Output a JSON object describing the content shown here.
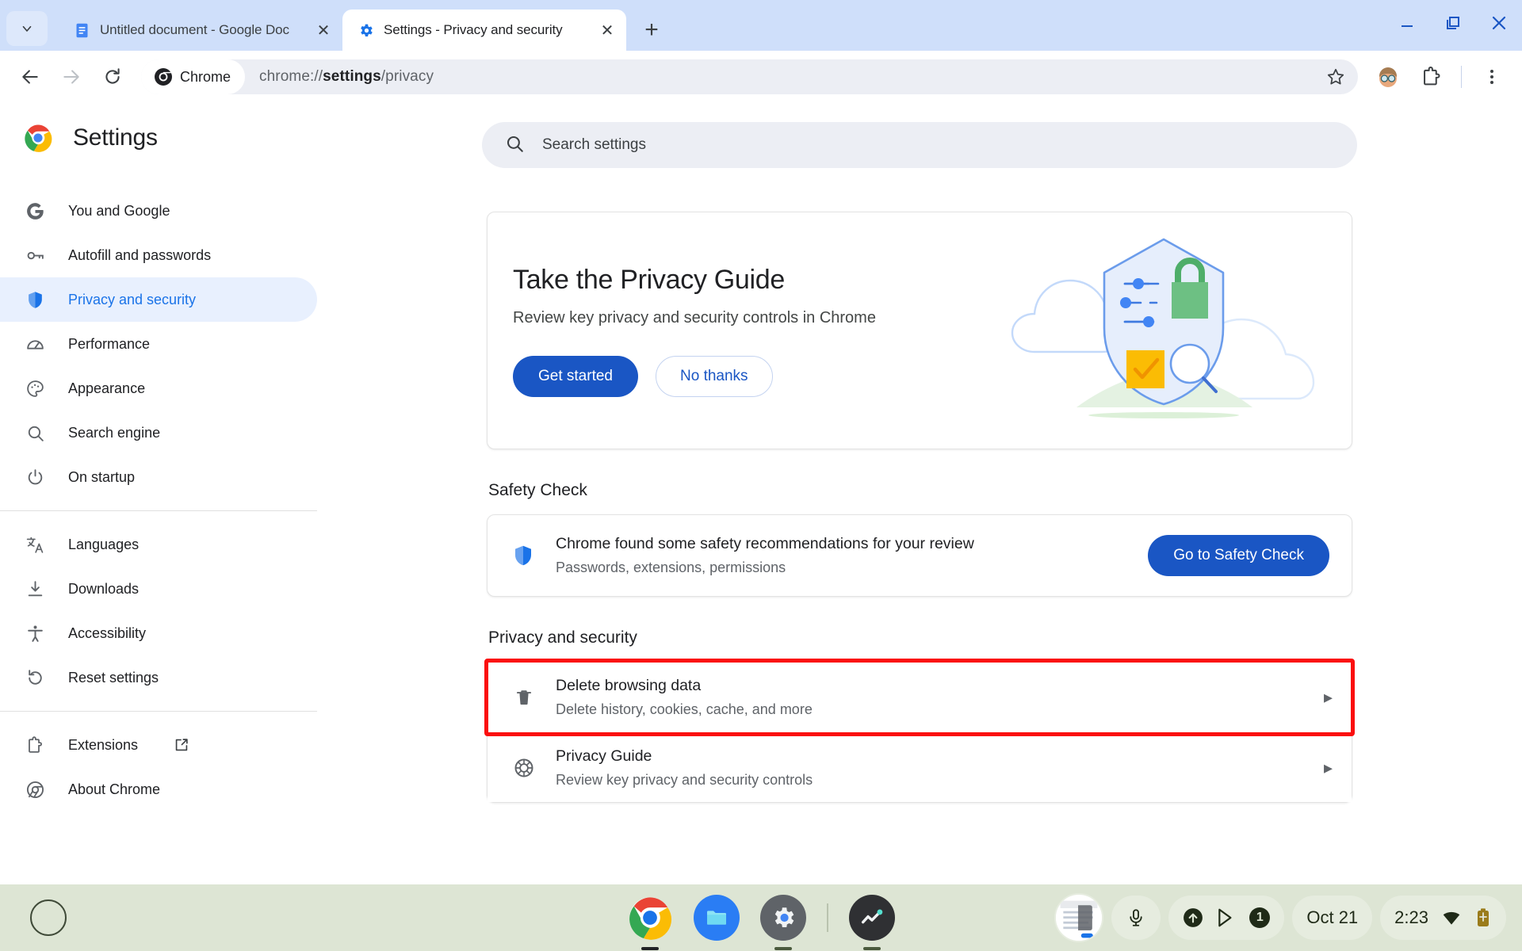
{
  "window": {
    "minimize_label": "–",
    "restore_label": "❐",
    "close_label": "✕"
  },
  "tabstrip": {
    "tab_search_icon": "chevron-down-icon",
    "new_tab_label": "+",
    "tabs": [
      {
        "title": "Untitled document - Google Doc",
        "favicon": "google-docs-icon",
        "active": false,
        "close_label": "✕"
      },
      {
        "title": "Settings - Privacy and security",
        "favicon": "settings-gear-icon",
        "active": true,
        "close_label": "✕"
      }
    ]
  },
  "toolbar": {
    "back_label": "←",
    "forward_label": "→",
    "reload_label": "⟳",
    "chrome_chip_label": "Chrome",
    "url_prefix": "chrome://",
    "url_bold": "settings",
    "url_suffix": "/privacy",
    "bookmark_icon": "star-icon",
    "profile_icon": "avatar-icon",
    "extensions_icon": "extensions-puzzle-icon",
    "menu_icon": "three-dot-menu-icon"
  },
  "sidebar": {
    "brand_title": "Settings",
    "brand_icon": "chrome-logo-icon",
    "items": [
      {
        "label": "You and Google",
        "icon": "google-g-icon",
        "selected": false
      },
      {
        "label": "Autofill and passwords",
        "icon": "key-icon",
        "selected": false
      },
      {
        "label": "Privacy and security",
        "icon": "shield-icon",
        "selected": true
      },
      {
        "label": "Performance",
        "icon": "speedometer-icon",
        "selected": false
      },
      {
        "label": "Appearance",
        "icon": "palette-icon",
        "selected": false
      },
      {
        "label": "Search engine",
        "icon": "search-icon",
        "selected": false
      },
      {
        "label": "On startup",
        "icon": "power-icon",
        "selected": false
      }
    ],
    "items_group2": [
      {
        "label": "Languages",
        "icon": "translate-icon",
        "selected": false
      },
      {
        "label": "Downloads",
        "icon": "download-icon",
        "selected": false
      },
      {
        "label": "Accessibility",
        "icon": "accessibility-icon",
        "selected": false
      },
      {
        "label": "Reset settings",
        "icon": "reset-icon",
        "selected": false
      }
    ],
    "items_group3": [
      {
        "label": "Extensions",
        "icon": "puzzle-icon",
        "external": true,
        "external_icon": "open-in-new-icon",
        "selected": false
      },
      {
        "label": "About Chrome",
        "icon": "chrome-outline-icon",
        "external": false,
        "selected": false
      }
    ]
  },
  "search": {
    "placeholder": "Search settings",
    "icon": "search-icon",
    "value": ""
  },
  "privacy_guide_card": {
    "title": "Take the Privacy Guide",
    "subtitle": "Review key privacy and security controls in Chrome",
    "primary_button": "Get started",
    "secondary_button": "No thanks",
    "illustration": "privacy-shield-illustration"
  },
  "safety_check": {
    "section_label": "Safety Check",
    "icon": "shield-icon",
    "title": "Chrome found some safety recommendations for your review",
    "subtitle": "Passwords, extensions, permissions",
    "button": "Go to Safety Check"
  },
  "privacy_section": {
    "section_label": "Privacy and security",
    "rows": [
      {
        "title": "Delete browsing data",
        "subtitle": "Delete history, cookies, cache, and more",
        "icon": "trash-icon",
        "chevron": "▸",
        "highlighted": true
      },
      {
        "title": "Privacy Guide",
        "subtitle": "Review key privacy and security controls",
        "icon": "privacy-guide-icon",
        "chevron": "▸",
        "highlighted": false
      }
    ]
  },
  "highlight_color": "#fb0f0f",
  "accent_color": "#1a73e8",
  "shelf": {
    "launcher_icon": "launcher-circle-icon",
    "apps": [
      {
        "name": "chrome-app-icon",
        "running": true
      },
      {
        "name": "files-app-icon",
        "running": false
      },
      {
        "name": "settings-app-icon",
        "running": true
      },
      {
        "name": "diagnostics-app-icon",
        "running": true
      }
    ],
    "screenshot_preview_icon": "screenshot-preview-icon",
    "mic_icon": "microphone-icon",
    "status_icons": [
      "upload-icon",
      "play-store-icon",
      "notification-count-icon"
    ],
    "notification_count": "1",
    "date": "Oct 21",
    "time": "2:23",
    "wifi_icon": "wifi-icon",
    "battery_icon": "battery-charging-icon"
  }
}
